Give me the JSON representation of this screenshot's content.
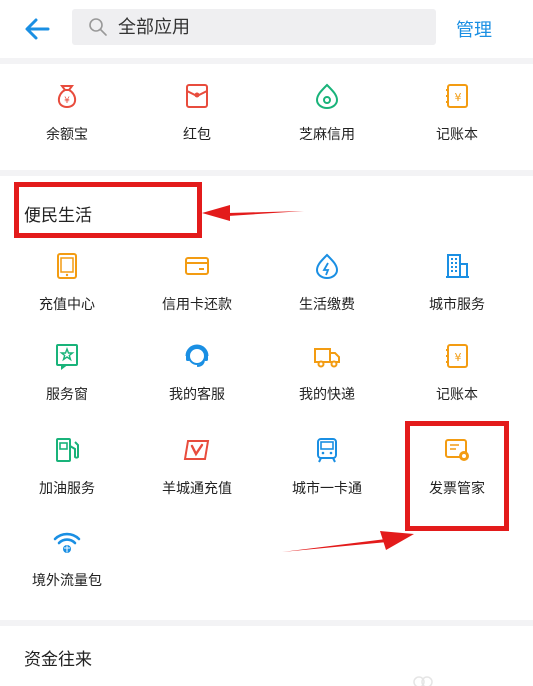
{
  "search": {
    "placeholder": "全部应用"
  },
  "header": {
    "manage_label": "管理"
  },
  "top_apps": [
    {
      "label": "余额宝",
      "icon": "yuebao-icon"
    },
    {
      "label": "红包",
      "icon": "red-envelope-icon"
    },
    {
      "label": "芝麻信用",
      "icon": "sesame-credit-icon"
    },
    {
      "label": "记账本",
      "icon": "ledger-icon"
    }
  ],
  "section_convenience": {
    "title": "便民生活",
    "items": [
      {
        "label": "充值中心",
        "icon": "phone-topup-icon"
      },
      {
        "label": "信用卡还款",
        "icon": "credit-card-icon"
      },
      {
        "label": "生活缴费",
        "icon": "utility-bill-icon"
      },
      {
        "label": "城市服务",
        "icon": "city-service-icon"
      },
      {
        "label": "服务窗",
        "icon": "service-window-icon"
      },
      {
        "label": "我的客服",
        "icon": "customer-service-icon"
      },
      {
        "label": "我的快递",
        "icon": "delivery-truck-icon"
      },
      {
        "label": "记账本",
        "icon": "ledger-icon"
      },
      {
        "label": "加油服务",
        "icon": "fuel-pump-icon"
      },
      {
        "label": "羊城通充值",
        "icon": "yangchengtong-icon"
      },
      {
        "label": "城市一卡通",
        "icon": "city-card-icon"
      },
      {
        "label": "发票管家",
        "icon": "invoice-icon"
      },
      {
        "label": "境外流量包",
        "icon": "wifi-globe-icon"
      }
    ]
  },
  "section_funds": {
    "title": "资金往来"
  },
  "colors": {
    "accent_blue": "#1a8fe3",
    "orange": "#f39c12",
    "red": "#e84c3d",
    "green": "#19b37a",
    "highlight_red": "#e31b1b"
  }
}
